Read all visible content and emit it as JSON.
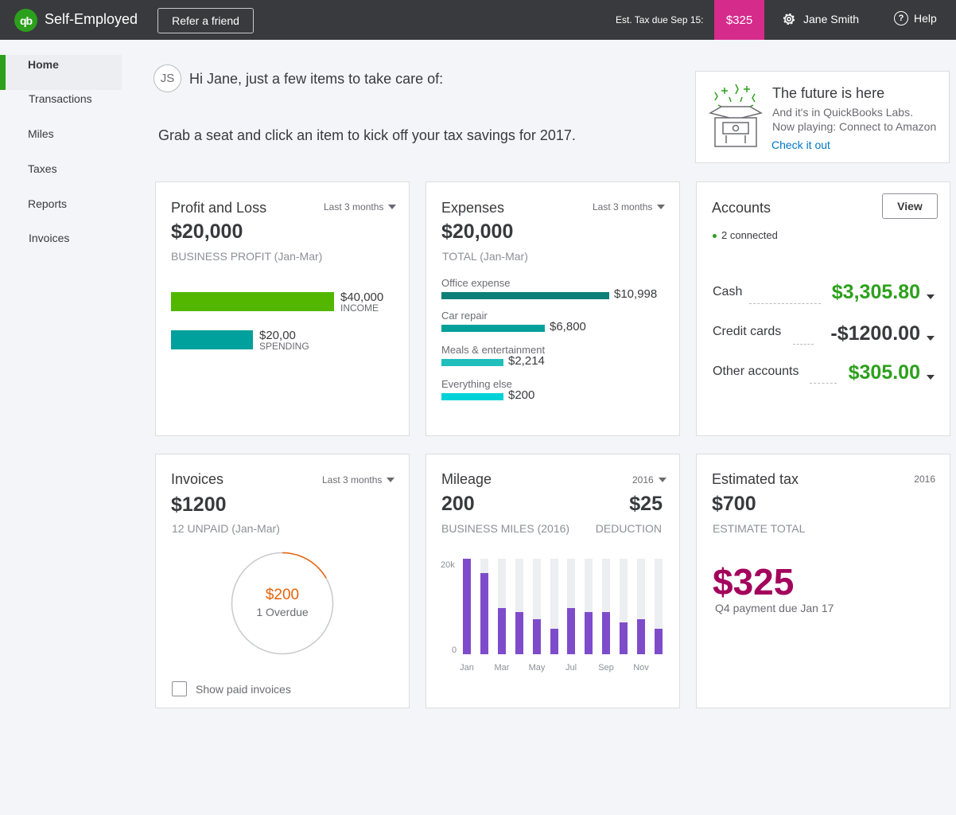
{
  "topbar": {
    "logo_text": "qb",
    "app_name": "Self-Employed",
    "refer_label": "Refer a friend",
    "est_tax_label": "Est. Tax due Sep 15:",
    "est_tax_value": "$325",
    "user_name": "Jane Smith",
    "help_label": "Help"
  },
  "sidebar": {
    "items": [
      {
        "label": "Home",
        "active": true
      },
      {
        "label": "Transactions"
      },
      {
        "label": "Miles"
      },
      {
        "label": "Taxes"
      },
      {
        "label": "Reports"
      },
      {
        "label": "Invoices"
      }
    ]
  },
  "greeting": {
    "initials": "JS",
    "text": "Hi Jane, just a few items to take care of:",
    "subtext": "Grab a seat and click an item to kick off your tax savings for 2017."
  },
  "labs": {
    "title": "The future is here",
    "line1": "And it's in QuickBooks Labs.",
    "line2": "Now playing: Connect to Amazon",
    "link": "Check it out"
  },
  "profit_loss": {
    "title": "Profit and Loss",
    "period": "Last 3 months",
    "amount": "$20,000",
    "subtitle": "BUSINESS PROFIT (Jan-Mar)",
    "income_value": "$40,000",
    "income_label": "INCOME",
    "spending_value": "$20,00",
    "spending_label": "SPENDING",
    "income_amount": 40000,
    "spending_amount": 20000
  },
  "expenses": {
    "title": "Expenses",
    "period": "Last 3 months",
    "amount": "$20,000",
    "subtitle": "TOTAL (Jan-Mar)",
    "items": [
      {
        "label": "Office expense",
        "value": "$10,998",
        "amount": 10998,
        "color": "#0d8078"
      },
      {
        "label": "Car repair",
        "value": "$6,800",
        "amount": 6800,
        "color": "#06a09a"
      },
      {
        "label": "Meals & entertainment",
        "value": "$2,214",
        "amount": 2214,
        "color": "#20bfbc"
      },
      {
        "label": "Everything else",
        "value": "$200",
        "amount": 200,
        "color": "#00d2d7"
      }
    ]
  },
  "accounts": {
    "title": "Accounts",
    "view_label": "View",
    "connected": "2 connected",
    "rows": [
      {
        "label": "Cash",
        "value": "$3,305.80",
        "color": "#2ca01c"
      },
      {
        "label": "Credit cards",
        "value": "-$1200.00",
        "color": "#393a3d"
      },
      {
        "label": "Other accounts",
        "value": "$305.00",
        "color": "#2ca01c"
      }
    ]
  },
  "invoices": {
    "title": "Invoices",
    "period": "Last 3 months",
    "amount": "$1200",
    "subtitle": "12 UNPAID (Jan-Mar)",
    "overdue_amount": "$200",
    "overdue_label": "1 Overdue",
    "overdue_fraction": 0.167,
    "show_paid_label": "Show paid invoices",
    "accent": "#e8630a"
  },
  "mileage": {
    "title": "Mileage",
    "period": "2016",
    "miles": "200",
    "deduction": "$25",
    "miles_label": "BUSINESS MILES (2016)",
    "deduction_label": "DEDUCTION",
    "chart_data": {
      "type": "bar",
      "categories": [
        "Jan",
        "Feb",
        "Mar",
        "Apr",
        "May",
        "Jun",
        "Jul",
        "Aug",
        "Sep",
        "Oct",
        "Nov",
        "Dec"
      ],
      "tick_labels": [
        "Jan",
        "Mar",
        "May",
        "Jul",
        "Sep",
        "Nov"
      ],
      "values": [
        20000,
        17000,
        9600,
        8800,
        7400,
        5300,
        9600,
        8800,
        8800,
        6700,
        7400,
        5300
      ],
      "ylim": [
        0,
        20000
      ],
      "yticks": [
        "20k",
        "0"
      ],
      "bar_color": "#7e4ccb",
      "track_color": "#eceef1"
    }
  },
  "estimated_tax": {
    "title": "Estimated tax",
    "year": "2016",
    "amount": "$700",
    "subtitle": "ESTIMATE TOTAL",
    "due_amount": "$325",
    "due_note": "Q4 payment due Jan 17"
  }
}
